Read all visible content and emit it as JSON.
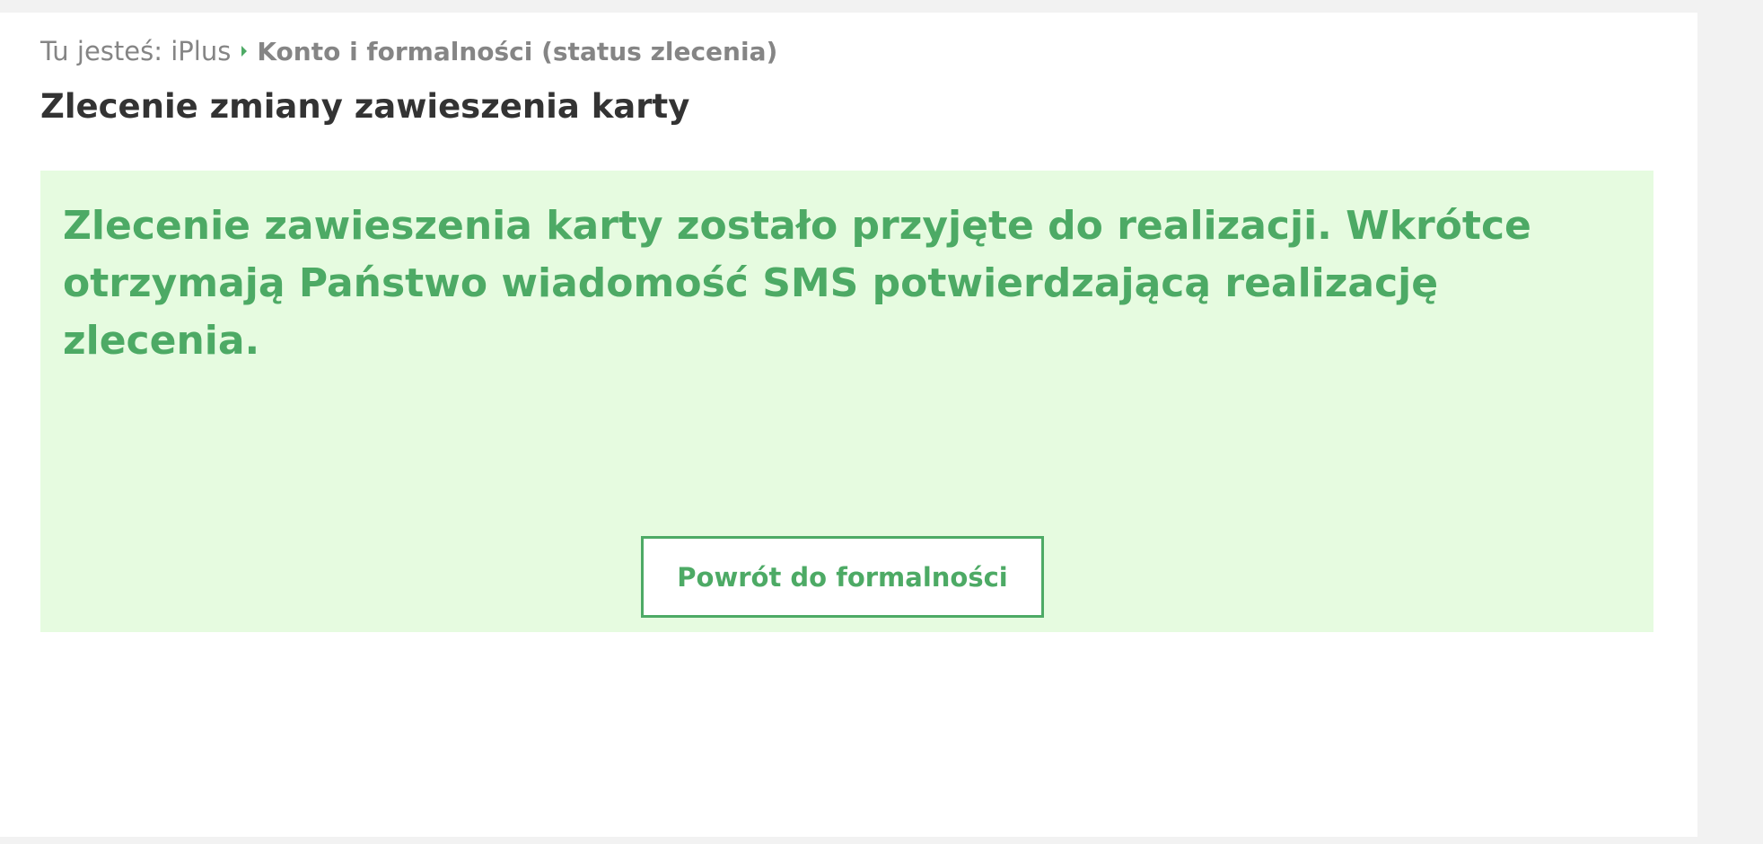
{
  "breadcrumb": {
    "prefix": "Tu jesteś: iPlus",
    "current": "Konto i formalności (status zlecenia)"
  },
  "page": {
    "title": "Zlecenie zmiany zawieszenia karty"
  },
  "message": {
    "text": "Zlecenie zawieszenia karty zostało przyjęte do realizacji. Wkrótce otrzymają Państwo wiadomość SMS potwierdzającą realizację zlecenia."
  },
  "actions": {
    "back_label": "Powrót do formalności"
  },
  "icons": {
    "breadcrumb_separator": "chevron-right-icon"
  },
  "colors": {
    "accent": "#4daa65",
    "panel_background": "#e6fbe0",
    "title": "#333333",
    "breadcrumb": "#858585",
    "page_background": "#f2f2f2"
  }
}
